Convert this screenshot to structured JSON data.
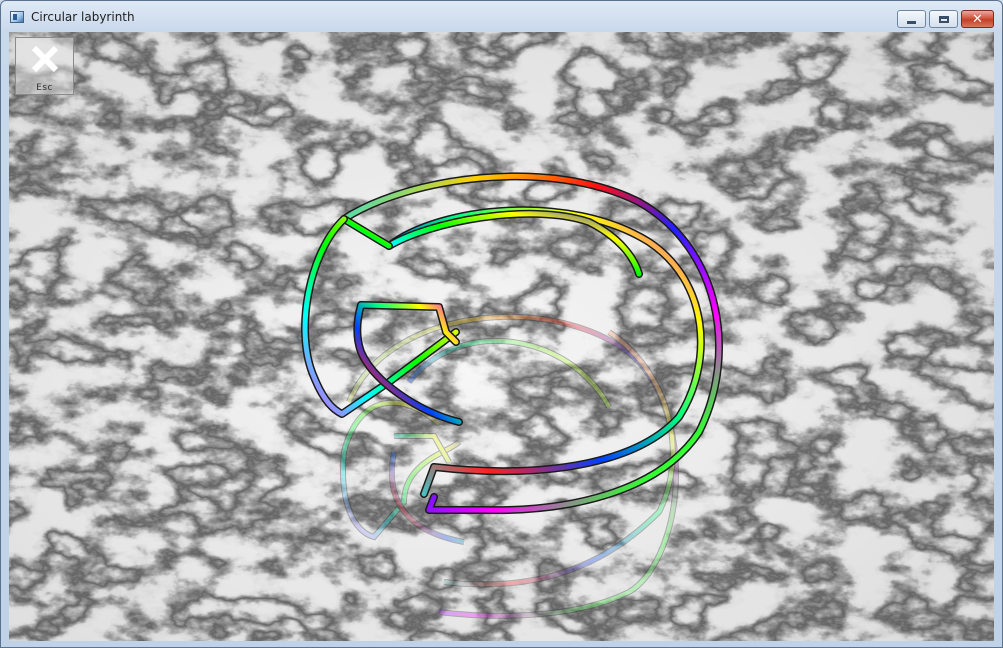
{
  "window": {
    "title": "Circular labyrinth"
  },
  "controls": {
    "minimize": "minimize-icon",
    "maximize": "maximize-icon",
    "close": "close-icon"
  },
  "esc_button": {
    "label": "Esc",
    "icon": "close-x-icon"
  },
  "scene": {
    "floor": "marble-floor",
    "object": "circular-labyrinth",
    "reflection": true,
    "colors": {
      "tube_outline": "#202020",
      "floor_base": "#e9e9e9",
      "floor_veins": "#5a5a5a"
    }
  }
}
